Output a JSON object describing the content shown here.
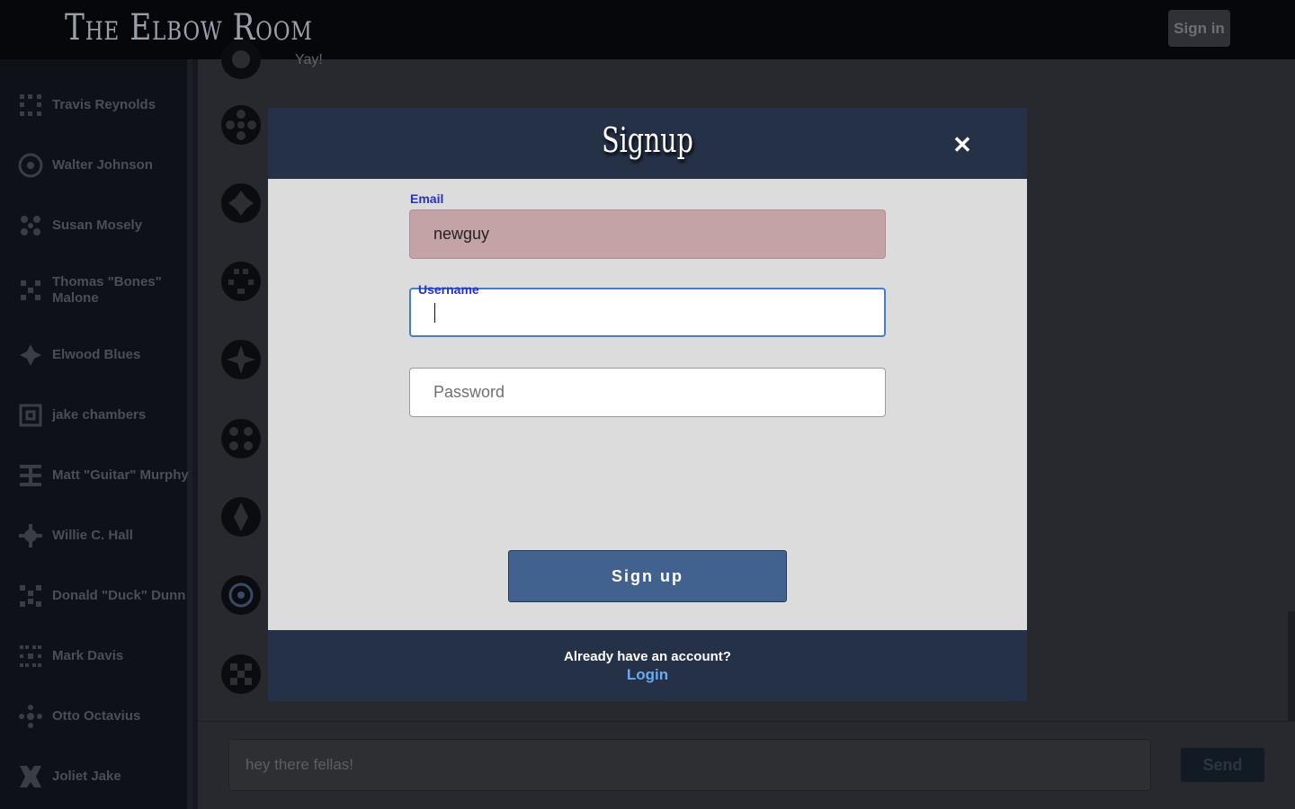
{
  "header": {
    "logo": "The Elbow Room",
    "signin_label": "Sign in"
  },
  "sidebar": {
    "users": [
      {
        "name": "Travis Reynolds"
      },
      {
        "name": "Walter Johnson"
      },
      {
        "name": "Susan Mosely"
      },
      {
        "name": "Thomas \"Bones\" Malone"
      },
      {
        "name": "Elwood Blues"
      },
      {
        "name": "jake chambers"
      },
      {
        "name": "Matt \"Guitar\" Murphy"
      },
      {
        "name": "Willie C. Hall"
      },
      {
        "name": "Donald \"Duck\" Dunn"
      },
      {
        "name": "Mark Davis"
      },
      {
        "name": "Otto Octavius"
      },
      {
        "name": "Joliet Jake"
      }
    ]
  },
  "chat": {
    "partial_message": "Yay!",
    "input_value": "hey there fellas!",
    "send_label": "Send"
  },
  "modal": {
    "title": "Signup",
    "close_symbol": "✕",
    "email_label": "Email",
    "email_value": "newguy",
    "username_label": "Username",
    "username_value": "",
    "password_placeholder": "Password",
    "submit_label": "Sign up",
    "footer_text": "Already have an account?",
    "footer_link": "Login"
  },
  "icons": [
    "close-icon",
    "avatar-icon"
  ]
}
